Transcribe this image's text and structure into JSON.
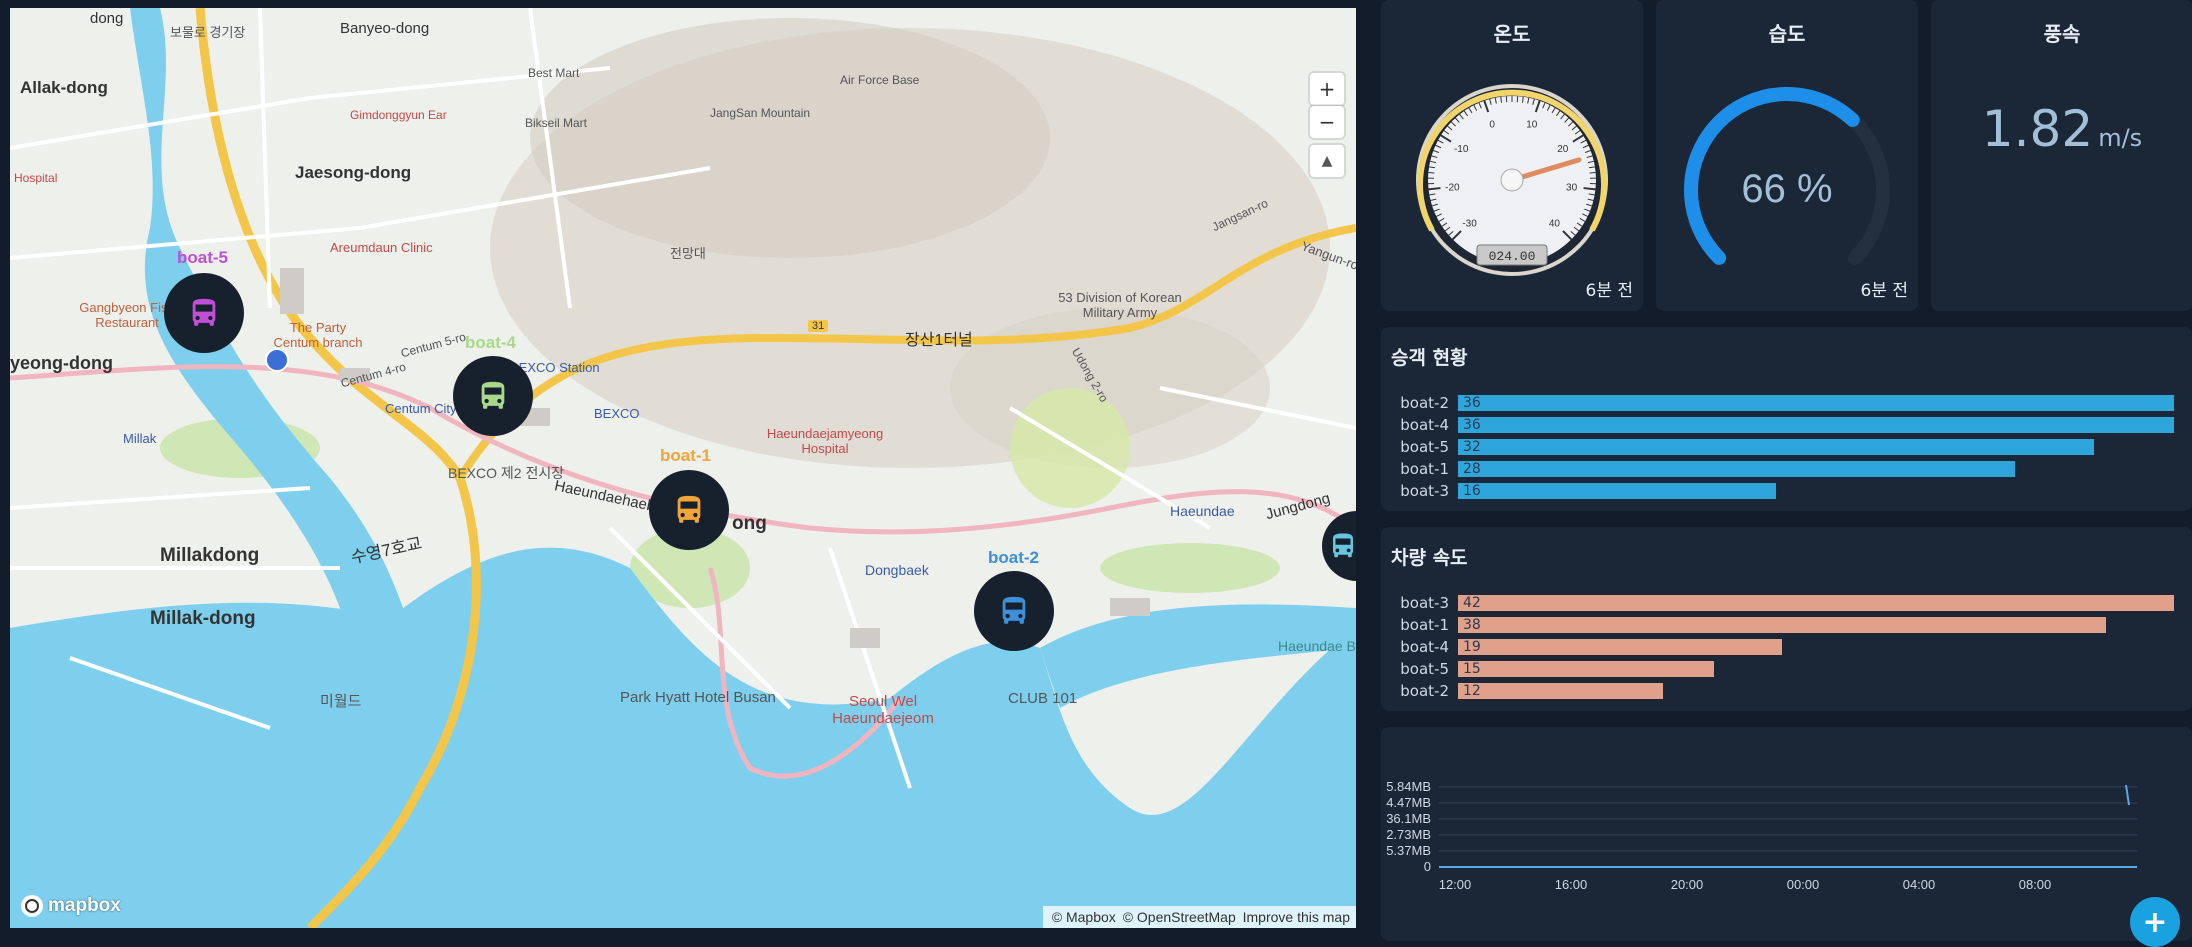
{
  "map": {
    "labels": {
      "dong_top": "dong",
      "gyeonggijang": "보물로 경기장",
      "banyeo_dong": "Banyeo-dong",
      "allak": "Allak-dong",
      "jaesong": "Jaesong-dong",
      "hospital": "Hospital",
      "gimdong": "Gimdonggyun Ear",
      "bestmart": "Best Mart",
      "biksel": "Bikseil Mart",
      "airforce": "Air Force Base",
      "jangsan": "JangSan Mountain",
      "areum": "Areumdaun Clinic",
      "gangbyeon": "Gangbyeon Fish Restaurant",
      "party": "The Party Centum branch",
      "centum5": "Centum 5-ro",
      "centum4": "Centum 4-ro",
      "centumcity": "Centum City",
      "bexco_station": "BEXCO Station",
      "bexco": "BEXCO",
      "bexco2": "BEXCO 제2 전시장",
      "millak_st": "Millak",
      "yeongdong": "yeong-dong",
      "millakdong": "Millakdong",
      "millak_dash": "Millak-dong",
      "haeundaehae": "Haeundaehaebyeon-ro",
      "haeundae_hosp": "Haeundaejamyeong Hospital",
      "dongbaek": "Dongbaek",
      "parkhyatt": "Park Hyatt Hotel Busan",
      "seoulwel": "Seoul Wel Haeundaejeom",
      "club101": "CLUB 101",
      "haeundae": "Haeundae",
      "jungdong": "Jungdong",
      "division53": "53 Division of Korean Military Army",
      "jangsan1": "장산1터널",
      "suyeong7": "수영7호교",
      "miworld": "미월드",
      "road31": "31",
      "yangun": "Yangun-ro",
      "jangsan_ro": "Jangsan-ro",
      "udong": "Udong 2-ro",
      "haeundae_b": "Haeundae B",
      "jangsan_dae": "전망대",
      "ong": "ong"
    },
    "controls": {
      "zoom_in": "+",
      "zoom_out": "−",
      "compass": "▲"
    },
    "markers": [
      {
        "name": "boat-5",
        "color": "#c04fd8"
      },
      {
        "name": "boat-4",
        "color": "#a8d88a"
      },
      {
        "name": "boat-1",
        "color": "#f0a43a"
      },
      {
        "name": "boat-2",
        "color": "#3d8fd8"
      }
    ],
    "attribution": {
      "mapbox": "© Mapbox",
      "osm": "© OpenStreetMap",
      "improve": "Improve this map"
    },
    "logo": "mapbox"
  },
  "temperature": {
    "title": "온도",
    "reading": "024.00",
    "time": "6분 전",
    "ticks": [
      "-30",
      "-20",
      "-10",
      "0",
      "10",
      "20",
      "30",
      "40"
    ],
    "value": 24
  },
  "humidity": {
    "title": "습도",
    "value_text": "66 %",
    "value": 66,
    "time": "6분 전"
  },
  "windspeed": {
    "title": "풍속",
    "value": "1.82",
    "unit": "m/s"
  },
  "passengers": {
    "title": "승객 현황",
    "max": 36,
    "rows": [
      {
        "name": "boat-2",
        "value": "36"
      },
      {
        "name": "boat-4",
        "value": "36"
      },
      {
        "name": "boat-5",
        "value": "32"
      },
      {
        "name": "boat-1",
        "value": "28"
      },
      {
        "name": "boat-3",
        "value": "16"
      }
    ]
  },
  "speed": {
    "title": "차량 속도",
    "max": 42,
    "rows": [
      {
        "name": "boat-3",
        "value": "42"
      },
      {
        "name": "boat-1",
        "value": "38"
      },
      {
        "name": "boat-4",
        "value": "19"
      },
      {
        "name": "boat-5",
        "value": "15"
      },
      {
        "name": "boat-2",
        "value": "12"
      }
    ]
  },
  "network": {
    "ylabels": [
      "5.84MB",
      "4.47MB",
      "36.1MB",
      "2.73MB",
      "5.37MB",
      "0"
    ],
    "xlabels": [
      "12:00",
      "16:00",
      "20:00",
      "00:00",
      "04:00",
      "08:00"
    ]
  },
  "colors": {
    "passenger_bar": "#2ea6dc",
    "speed_bar": "#e0a08a",
    "accent": "#1aa1e0"
  }
}
